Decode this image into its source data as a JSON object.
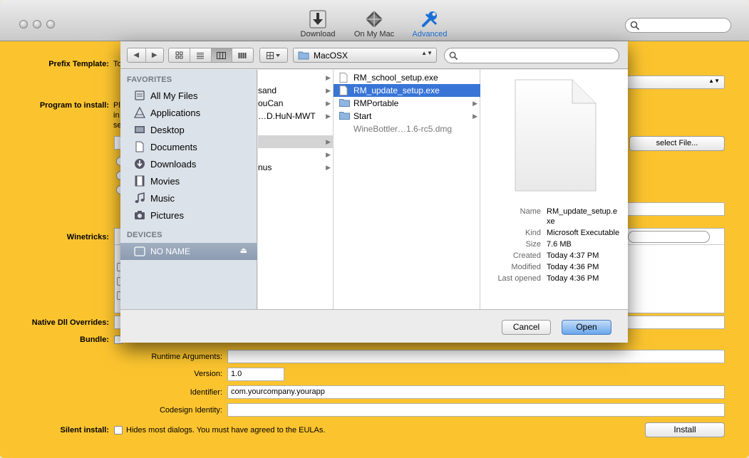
{
  "toolbar": {
    "download": "Download",
    "on_my_mac": "On My Mac",
    "advanced": "Advanced",
    "search_placeholder": ""
  },
  "form": {
    "prefix_template": "Prefix Template:",
    "prefix_template_value": "To",
    "program_to_install": "Program to install:",
    "program_text_1": "Pl",
    "program_text_2": "in",
    "program_text_3": "se",
    "select_file": "select File...",
    "winetricks": "Winetricks:",
    "native_dll": "Native Dll Overrides:",
    "bundle": "Bundle:",
    "runtime_args": "Runtime Arguments:",
    "runtime_args_value": "",
    "version": "Version:",
    "version_value": "1.0",
    "identifier": "Identifier:",
    "identifier_value": "com.yourcompany.yourapp",
    "codesign": "Codesign Identity:",
    "codesign_value": "",
    "silent_install": "Silent install:",
    "silent_desc": "Hides most dialogs. You must have agreed to the EULAs.",
    "install": "Install"
  },
  "dialog": {
    "location": "MacOSX",
    "search_placeholder": "",
    "favorites_header": "FAVORITES",
    "favorites": [
      {
        "label": "All My Files",
        "icon": "all-my-files-icon"
      },
      {
        "label": "Applications",
        "icon": "applications-icon"
      },
      {
        "label": "Desktop",
        "icon": "desktop-icon"
      },
      {
        "label": "Documents",
        "icon": "documents-icon"
      },
      {
        "label": "Downloads",
        "icon": "downloads-icon"
      },
      {
        "label": "Movies",
        "icon": "movies-icon"
      },
      {
        "label": "Music",
        "icon": "music-icon"
      },
      {
        "label": "Pictures",
        "icon": "pictures-icon"
      }
    ],
    "devices_header": "DEVICES",
    "device": "NO NAME",
    "col1": [
      "sand",
      "ouCan",
      "…D.HuN-MWT",
      "",
      "nus"
    ],
    "col2": [
      {
        "label": "RM_school_setup.exe",
        "type": "file"
      },
      {
        "label": "RM_update_setup.exe",
        "type": "file",
        "selected": true
      },
      {
        "label": "RMPortable",
        "type": "folder"
      },
      {
        "label": "Start",
        "type": "folder"
      },
      {
        "label": "WineBottler…1.6-rc5.dmg",
        "type": "dmg"
      }
    ],
    "info": {
      "name_k": "Name",
      "name_v": "RM_update_setup.e",
      "name_v2": "xe",
      "kind_k": "Kind",
      "kind_v": "Microsoft Executable",
      "size_k": "Size",
      "size_v": "7.6 MB",
      "created_k": "Created",
      "created_v": "Today 4:37 PM",
      "modified_k": "Modified",
      "modified_v": "Today 4:36 PM",
      "opened_k": "Last opened",
      "opened_v": "Today 4:36 PM"
    },
    "cancel": "Cancel",
    "open": "Open"
  },
  "colors": {
    "background": "#fbc42f",
    "selection": "#3875d7",
    "advanced": "#1a6fd6"
  }
}
